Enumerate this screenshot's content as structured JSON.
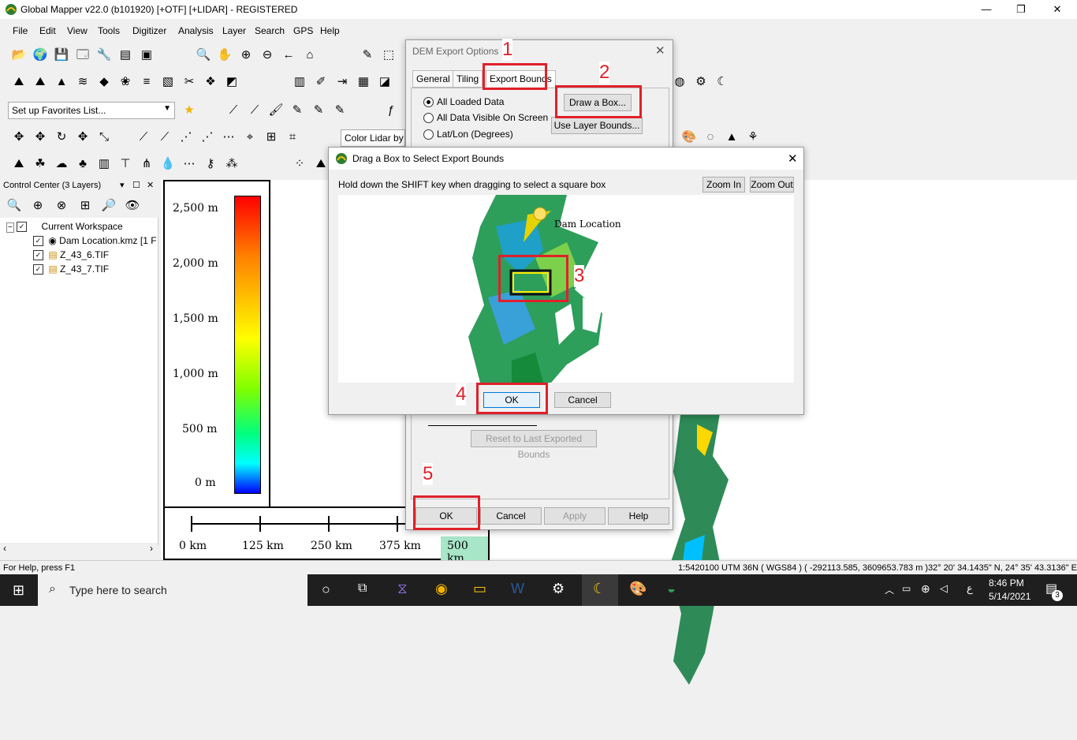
{
  "app": {
    "title": "Global Mapper v22.0 (b101920) [+OTF] [+LIDAR] - REGISTERED",
    "window_controls": [
      "—",
      "❐",
      "✕"
    ]
  },
  "menu": [
    "File",
    "Edit",
    "View",
    "Tools",
    "Digitizer",
    "Analysis",
    "Layer",
    "Search",
    "GPS",
    "Help"
  ],
  "toolbar": {
    "favorites_dropdown": "Set up Favorites List...",
    "color_lidar_dropdown": "Color Lidar by"
  },
  "control_center": {
    "title": "Control Center (3 Layers)",
    "tree": [
      {
        "label": "Current Workspace",
        "checked": true
      },
      {
        "label": "Dam Location.kmz [1 F",
        "checked": true
      },
      {
        "label": "Z_43_6.TIF",
        "checked": true
      },
      {
        "label": "Z_43_7.TIF",
        "checked": true
      }
    ]
  },
  "legend": {
    "labels": [
      "2,500 m",
      "2,000 m",
      "1,500 m",
      "1,000 m",
      "500 m",
      "0 m"
    ]
  },
  "scalebar": {
    "labels": [
      "0 km",
      "125 km",
      "250 km",
      "375 km",
      "500 km"
    ]
  },
  "dem_export": {
    "title": "DEM Export Options",
    "tabs": [
      "General",
      "Tiling",
      "Export Bounds"
    ],
    "active_tab": "Export Bounds",
    "options": [
      {
        "label": "All Loaded Data",
        "selected": true
      },
      {
        "label": "All Data Visible On Screen",
        "selected": false
      },
      {
        "label": "Lat/Lon (Degrees)",
        "selected": false
      }
    ],
    "draw_box": "Draw a Box...",
    "layer_bounds": "Use Layer Bounds...",
    "reset_bounds": "Reset to Last Exported Bounds",
    "ok": "OK",
    "cancel": "Cancel",
    "apply": "Apply",
    "help": "Help"
  },
  "drag_dialog": {
    "title": "Drag a Box to Select Export Bounds",
    "instruction": "Hold down the SHIFT key when dragging to select a square box",
    "zoom_in": "Zoom In",
    "zoom_out": "Zoom Out",
    "map_label": "Dam Location",
    "ok": "OK",
    "cancel": "Cancel"
  },
  "steps": [
    "1",
    "2",
    "3",
    "4",
    "5"
  ],
  "status": {
    "help": "For Help, press F1",
    "scale": "1:5420100",
    "utm": "UTM 36N ( WGS84 ) ( -292113.585, 3609653.783 m )",
    "latlon": "32° 20' 34.1435\" N, 24° 35' 43.3136\" E"
  },
  "taskbar": {
    "search_placeholder": "Type here to search",
    "time": "8:46 PM",
    "date": "5/14/2021",
    "lang": "ع",
    "notif_count": "3"
  },
  "colors": {
    "accent_red": "#e0202a",
    "taskbar": "#1f1f1f"
  }
}
